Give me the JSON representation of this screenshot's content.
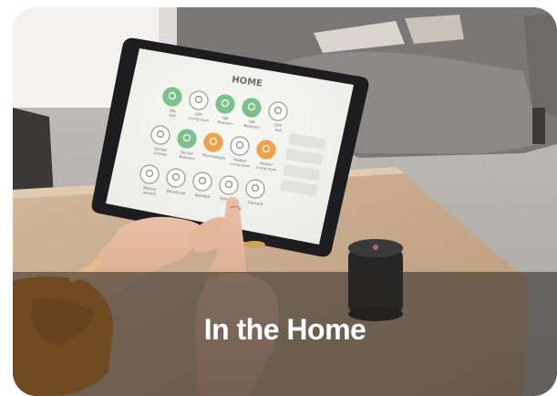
{
  "card": {
    "caption": "In the Home"
  },
  "tablet": {
    "title": "HOME",
    "devices": [
      {
        "icon": "bulb-icon",
        "label": "ON",
        "sub": "Hall",
        "state": "on"
      },
      {
        "icon": "bulb-icon",
        "label": "OFF",
        "sub": "Living room",
        "state": "off"
      },
      {
        "icon": "bulb-icon",
        "label": "ON",
        "sub": "Bedroom",
        "state": "on"
      },
      {
        "icon": "bulb-icon",
        "label": "ON",
        "sub": "Bedroom",
        "state": "on"
      },
      {
        "icon": "bulb-icon",
        "label": "OFF",
        "sub": "Hall",
        "state": "off"
      },
      {
        "icon": "socket-icon",
        "label": "Socket",
        "sub": "Kitchen",
        "state": "off"
      },
      {
        "icon": "socket-icon",
        "label": "Socket",
        "sub": "Bedroom",
        "state": "on"
      },
      {
        "icon": "thermostat-icon",
        "label": "Thermostats",
        "sub": "",
        "state": "warm"
      },
      {
        "icon": "heater-icon",
        "label": "Heater",
        "sub": "Living room",
        "state": "off"
      },
      {
        "icon": "heater-icon",
        "label": "Heater",
        "sub": "Living room",
        "state": "warm"
      },
      {
        "icon": "motion-sensor-icon",
        "label": "Motion",
        "sub": "sensors",
        "state": "off"
      },
      {
        "icon": "broadcast-icon",
        "label": "Broadcast",
        "sub": "",
        "state": "off"
      },
      {
        "icon": "speaker-icon",
        "label": "Speaker",
        "sub": "",
        "state": "off"
      },
      {
        "icon": "detection-icon",
        "label": "Detection",
        "sub": "",
        "state": "off"
      },
      {
        "icon": "camera-icon",
        "label": "Camera",
        "sub": "",
        "state": "off"
      }
    ]
  },
  "colors": {
    "accent_green": "#7cc18b",
    "accent_orange": "#f0a24a",
    "overlay": "#2a2826"
  }
}
